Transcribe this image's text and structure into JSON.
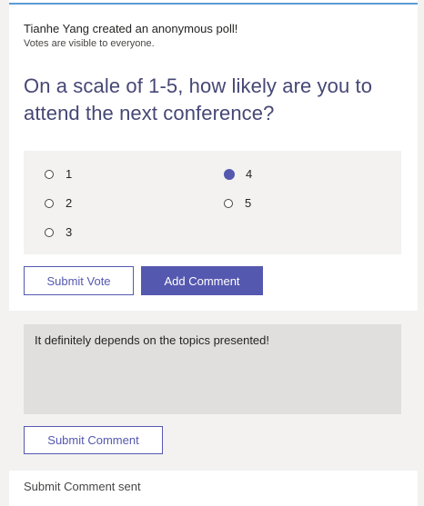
{
  "poll": {
    "creator_line": "Tianhe Yang created an anonymous poll!",
    "visibility_note": "Votes are visible to everyone.",
    "question": "On a scale of 1-5, how likely are you to attend the next conference?",
    "options": [
      {
        "label": "1",
        "selected": false
      },
      {
        "label": "2",
        "selected": false
      },
      {
        "label": "3",
        "selected": false
      },
      {
        "label": "4",
        "selected": true
      },
      {
        "label": "5",
        "selected": false
      }
    ],
    "submit_vote_label": "Submit Vote",
    "add_comment_label": "Add Comment"
  },
  "comment": {
    "text": "It definitely depends on the topics presented!",
    "submit_label": "Submit Comment"
  },
  "status": {
    "message": "Submit Comment sent"
  },
  "colors": {
    "accent": "#5558af",
    "question": "#464775",
    "panel_bg": "#f3f2f1"
  }
}
